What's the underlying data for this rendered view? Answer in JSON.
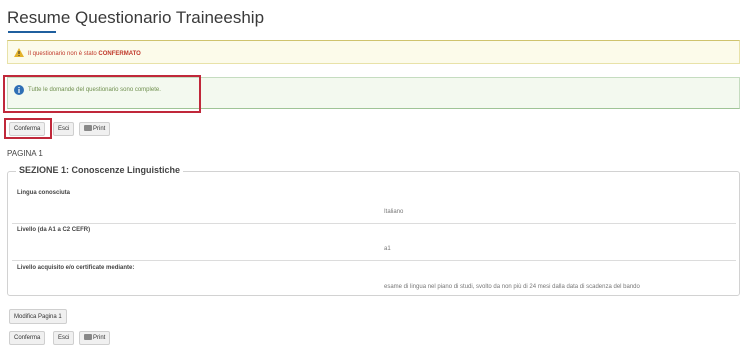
{
  "page": {
    "title": "Resume Questionario Traineeship"
  },
  "alerts": {
    "warning": {
      "icon": "warning-icon",
      "text": "Il questionario non è stato",
      "emphasis": "CONFERMATO"
    },
    "info": {
      "icon": "info-icon",
      "text": "Tutte le domande del questionario sono complete."
    }
  },
  "toolbar_top": {
    "confirm_label": "Conferma",
    "exit_label": "Esci",
    "print_label": "Print"
  },
  "page_label": "PAGINA 1",
  "section": {
    "title": "SEZIONE 1: Conoscenze Linguistiche",
    "questions": [
      {
        "label": "Lingua conosciuta",
        "answer": "Italiano"
      },
      {
        "label": "Livello (da A1 a C2 CEFR)",
        "answer": "a1"
      },
      {
        "label": "Livello acquisito e/o certificate mediante:",
        "answer": "esame di lingua nel piano di studi, svolto da non più di 24 mesi dalla data di scadenza del bando"
      }
    ]
  },
  "edit_button_label": "Modifica Pagina 1",
  "toolbar_bottom": {
    "confirm_label": "Conferma",
    "exit_label": "Esci",
    "print_label": "Print"
  },
  "colors": {
    "accent": "#1f5f9e",
    "highlight": "#c0283a",
    "warning_text": "#c0392b",
    "info_text": "#6f8f4e"
  }
}
